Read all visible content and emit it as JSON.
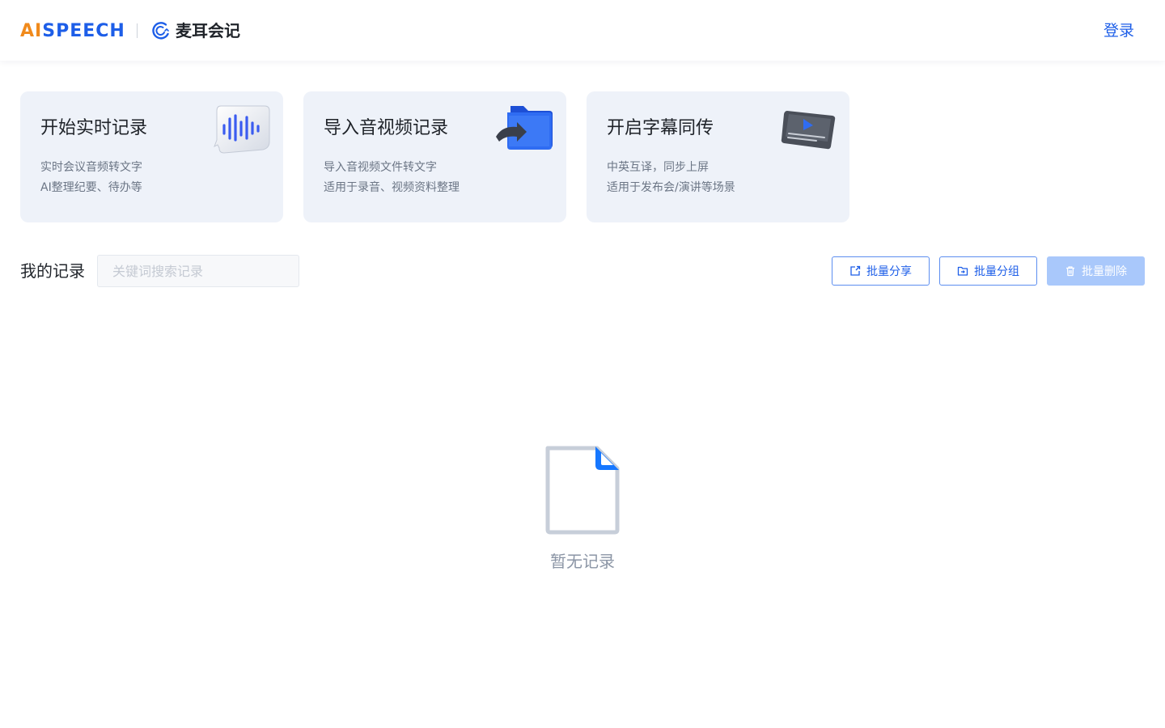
{
  "header": {
    "brand_ai": "AI",
    "brand_rest": "SPEECH",
    "product_name": "麦耳会记",
    "login_label": "登录",
    "brand_color_blue": "#1d5ee8",
    "brand_color_orange": "#f08a1c"
  },
  "cards": [
    {
      "title": "开始实时记录",
      "desc1": "实时会议音频转文字",
      "desc2": "AI整理纪要、待办等",
      "icon": "voice-wave-icon"
    },
    {
      "title": "导入音视频记录",
      "desc1": "导入音视频文件转文字",
      "desc2": "适用于录音、视频资料整理",
      "icon": "import-folder-icon"
    },
    {
      "title": "开启字幕同传",
      "desc1": "中英互译，同步上屏",
      "desc2": "适用于发布会/演讲等场景",
      "icon": "subtitle-screen-icon"
    }
  ],
  "records": {
    "title": "我的记录",
    "search_placeholder": "关键词搜索记录",
    "search_value": "",
    "batch_share": "批量分享",
    "batch_group": "批量分组",
    "batch_delete": "批量删除"
  },
  "empty": {
    "text": "暂无记录",
    "icon": "empty-document-icon"
  }
}
